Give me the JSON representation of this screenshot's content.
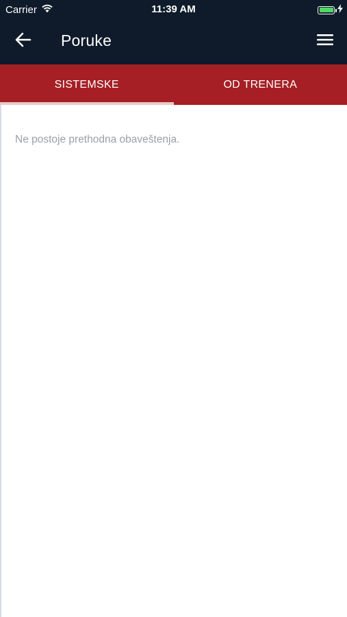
{
  "status_bar": {
    "carrier": "Carrier",
    "time": "11:39 AM",
    "battery_level": 1.0,
    "battery_color": "#4cd964",
    "icons": [
      "wifi-icon",
      "battery-icon",
      "charging-bolt-icon"
    ]
  },
  "header": {
    "title": "Poruke",
    "background_color": "#0f1b2a",
    "back_icon": "arrow-left-icon",
    "menu_icon": "hamburger-menu-icon"
  },
  "tabs": {
    "accent_color": "#a51f24",
    "items": [
      {
        "label": "SISTEMSKE",
        "active": true
      },
      {
        "label": "OD TRENERA",
        "active": false
      }
    ]
  },
  "content": {
    "empty_message": "Ne postoje prethodna obaveštenja."
  }
}
